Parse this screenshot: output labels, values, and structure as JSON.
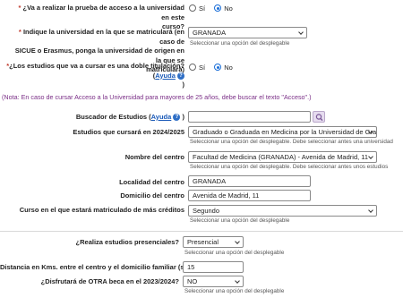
{
  "q_prueba_acceso": {
    "label_line1": "¿Va a realizar la prueba de acceso a la universidad en este",
    "label_line2": "curso?",
    "options": [
      "Sí",
      "No"
    ],
    "selected": "No"
  },
  "q_universidad": {
    "label_line1": "Indique la universidad en la que se matriculará (en caso de",
    "label_line2": "SICUE o Erasmus, ponga la universidad de origen en la que se",
    "label_line3": "matriculará)",
    "value": "GRANADA",
    "hint": "Seleccionar una opción del desplegable"
  },
  "q_doble_titulacion": {
    "label": "¿Los estudios que va a cursar es una doble titulación? (",
    "help_link": "Ayuda",
    "close_paren": ")",
    "options": [
      "Sí",
      "No"
    ],
    "selected": "No"
  },
  "note": "(Nota: En caso de cursar Acceso a la Universidad para mayores de 25 años, debe buscar el texto \"Acceso\".)",
  "buscador": {
    "label": "Buscador de Estudios (",
    "help_link": "Ayuda",
    "close_paren": ")",
    "value": ""
  },
  "estudios": {
    "label": "Estudios que cursará en 2024/2025",
    "value": "Graduado o Graduada en Medicina por la Universidad de Granada",
    "hint": "Seleccionar una opción del desplegable. Debe seleccionar antes una universidad"
  },
  "centro": {
    "label": "Nombre del centro",
    "value": "Facultad de Medicina (GRANADA) - Avenida de Madrid, 11",
    "hint": "Seleccionar una opción del desplegable. Debe seleccionar antes unos estudios"
  },
  "localidad": {
    "label": "Localidad del centro",
    "value": "GRANADA"
  },
  "domicilio": {
    "label": "Domicilio del centro",
    "value": "Avenida de Madrid, 11"
  },
  "curso": {
    "label": "Curso en el que estará matriculado de más créditos",
    "value": "Segundo",
    "hint": "Seleccionar una opción del desplegable"
  },
  "presenciales": {
    "label": "¿Realiza estudios presenciales?",
    "value": "Presencial",
    "hint": "Seleccionar una opción del desplegable"
  },
  "distancia": {
    "label": "Distancia en Kms. entre el centro y el domicilio familiar (sólo ida)",
    "value": "15"
  },
  "otra_beca": {
    "label": "¿Disfrutará de OTRA beca en el 2023/2024?",
    "value": "NO",
    "hint": "Seleccionar una opción del desplegable"
  },
  "required_mark": "*",
  "help_icon_glyph": "?",
  "search_icon": "search-icon",
  "colors": {
    "required": "#c0392b",
    "link": "#1a5ab8",
    "note": "#7a2e86",
    "radio_on": "#1a6ed8",
    "help_icon": "#2f6fc6"
  }
}
